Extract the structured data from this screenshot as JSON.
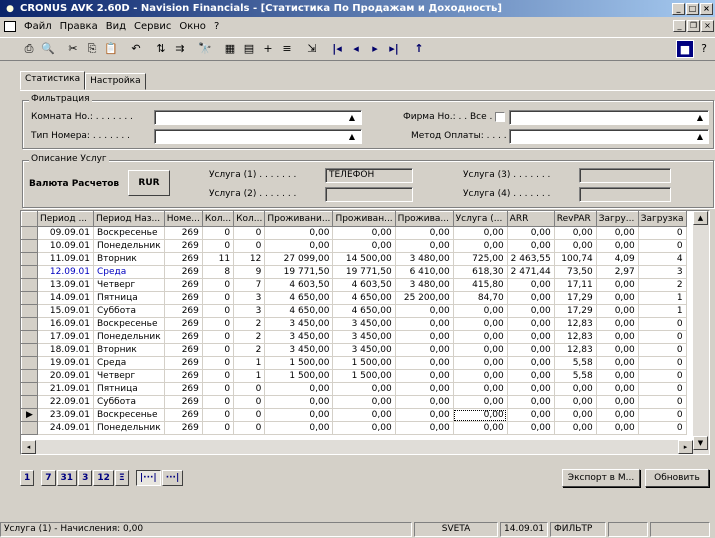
{
  "window": {
    "title": "CRONUS AVK 2.60D - Navision Financials - [Статистика По Продажам и Доходность]"
  },
  "menu": {
    "items": [
      "Файл",
      "Правка",
      "Вид",
      "Сервис",
      "Окно",
      "?"
    ]
  },
  "tabs": [
    {
      "label": "Статистика"
    },
    {
      "label": "Настройка"
    }
  ],
  "filter": {
    "group_title": "Фильтрация",
    "room_label": "Комната Но.: . . . . . . .",
    "room_value": "",
    "number_type_label": "Тип Номера: . . . . . . .",
    "number_type_value": "",
    "firm_label": "Фирма Но.: . . Все .",
    "firm_value": "",
    "payment_label": "Метод Оплаты: . . . . .",
    "payment_value": ""
  },
  "services": {
    "group_title": "Описание Услуг",
    "currency_label": "Валюта Расчетов",
    "currency_value": "RUR",
    "service1_label": "Услуга (1) . . . . . . .",
    "service1_value": "ТЕЛЕФОН",
    "service2_label": "Услуга (2) . . . . . . .",
    "service2_value": "",
    "service3_label": "Услуга (3) . . . . . . .",
    "service3_value": "",
    "service4_label": "Услуга (4) . . . . . . .",
    "service4_value": ""
  },
  "table": {
    "columns": [
      "Период ...",
      "Период Наз...",
      "Номе...",
      "Кол...",
      "Кол...",
      "Проживани...",
      "Проживан...",
      "Прожива...",
      "Услуга (...",
      "ARR",
      "RevPAR",
      "Загру...",
      "Загрузка"
    ],
    "rows": [
      [
        "09.09.01",
        "Воскресенье",
        "269",
        "0",
        "0",
        "0,00",
        "0,00",
        "0,00",
        "0,00",
        "0,00",
        "0,00",
        "0,00",
        "0"
      ],
      [
        "10.09.01",
        "Понедельник",
        "269",
        "0",
        "0",
        "0,00",
        "0,00",
        "0,00",
        "0,00",
        "0,00",
        "0,00",
        "0,00",
        "0"
      ],
      [
        "11.09.01",
        "Вторник",
        "269",
        "11",
        "12",
        "27 099,00",
        "14 500,00",
        "3 480,00",
        "725,00",
        "2 463,55",
        "100,74",
        "4,09",
        "4"
      ],
      [
        "12.09.01",
        "Среда",
        "269",
        "8",
        "9",
        "19 771,50",
        "19 771,50",
        "6 410,00",
        "618,30",
        "2 471,44",
        "73,50",
        "2,97",
        "3"
      ],
      [
        "13.09.01",
        "Четверг",
        "269",
        "0",
        "7",
        "4 603,50",
        "4 603,50",
        "3 480,00",
        "415,80",
        "0,00",
        "17,11",
        "0,00",
        "2"
      ],
      [
        "14.09.01",
        "Пятница",
        "269",
        "0",
        "3",
        "4 650,00",
        "4 650,00",
        "25 200,00",
        "84,70",
        "0,00",
        "17,29",
        "0,00",
        "1"
      ],
      [
        "15.09.01",
        "Суббота",
        "269",
        "0",
        "3",
        "4 650,00",
        "4 650,00",
        "0,00",
        "0,00",
        "0,00",
        "17,29",
        "0,00",
        "1"
      ],
      [
        "16.09.01",
        "Воскресенье",
        "269",
        "0",
        "2",
        "3 450,00",
        "3 450,00",
        "0,00",
        "0,00",
        "0,00",
        "12,83",
        "0,00",
        "0"
      ],
      [
        "17.09.01",
        "Понедельник",
        "269",
        "0",
        "2",
        "3 450,00",
        "3 450,00",
        "0,00",
        "0,00",
        "0,00",
        "12,83",
        "0,00",
        "0"
      ],
      [
        "18.09.01",
        "Вторник",
        "269",
        "0",
        "2",
        "3 450,00",
        "3 450,00",
        "0,00",
        "0,00",
        "0,00",
        "12,83",
        "0,00",
        "0"
      ],
      [
        "19.09.01",
        "Среда",
        "269",
        "0",
        "1",
        "1 500,00",
        "1 500,00",
        "0,00",
        "0,00",
        "0,00",
        "5,58",
        "0,00",
        "0"
      ],
      [
        "20.09.01",
        "Четверг",
        "269",
        "0",
        "1",
        "1 500,00",
        "1 500,00",
        "0,00",
        "0,00",
        "0,00",
        "5,58",
        "0,00",
        "0"
      ],
      [
        "21.09.01",
        "Пятница",
        "269",
        "0",
        "0",
        "0,00",
        "0,00",
        "0,00",
        "0,00",
        "0,00",
        "0,00",
        "0,00",
        "0"
      ],
      [
        "22.09.01",
        "Суббота",
        "269",
        "0",
        "0",
        "0,00",
        "0,00",
        "0,00",
        "0,00",
        "0,00",
        "0,00",
        "0,00",
        "0"
      ],
      [
        "23.09.01",
        "Воскресенье",
        "269",
        "0",
        "0",
        "0,00",
        "0,00",
        "0,00",
        "0,00",
        "0,00",
        "0,00",
        "0,00",
        "0"
      ],
      [
        "24.09.01",
        "Понедельник",
        "269",
        "0",
        "0",
        "0,00",
        "0,00",
        "0,00",
        "0,00",
        "0,00",
        "0,00",
        "0,00",
        "0"
      ]
    ],
    "highlight_row": 3,
    "current_row": 14
  },
  "periods": [
    "1",
    "7",
    "31",
    "3",
    "12",
    "Ξ"
  ],
  "buttons": {
    "export": "Экспорт в М...",
    "refresh": "Обновить"
  },
  "status": {
    "message": "Услуга (1) - Начисления: 0,00",
    "user": "SVETA",
    "date": "14.09.01",
    "filter": "ФИЛЬТР"
  }
}
